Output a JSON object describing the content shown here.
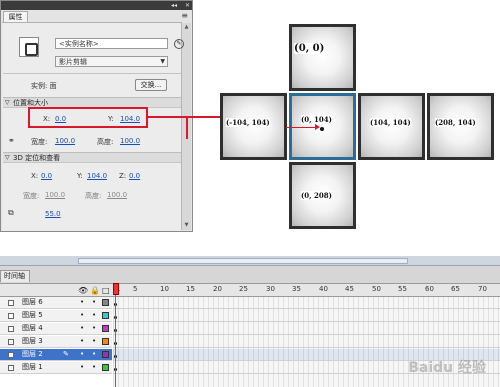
{
  "panel": {
    "tab": "属性",
    "instance_name_placeholder": "<实例名称>",
    "type": "影片剪辑",
    "instance_label": "实例: 面",
    "swap_button": "交换...",
    "section_position": "位置和大小",
    "x_label": "X:",
    "x_value": "0.0",
    "y_label": "Y:",
    "y_value": "104.0",
    "width_label": "宽度:",
    "width_value": "100.0",
    "height_label": "高度:",
    "height_value": "100.0",
    "section_3d": "3D 定位和查看",
    "x3d_label": "X:",
    "x3d_value": "0.0",
    "y3d_label": "Y:",
    "y3d_value": "104.0",
    "z3d_label": "Z:",
    "z3d_value": "0.0",
    "width3d_label": "宽度:",
    "width3d_value": "100.0",
    "height3d_label": "高度:",
    "height3d_value": "100.0",
    "fov_value": "55.0"
  },
  "stage": {
    "cells": [
      {
        "id": "top",
        "label": "(0, 0)"
      },
      {
        "id": "left",
        "label": "(-104, 104)"
      },
      {
        "id": "center",
        "label": "(0, 104)"
      },
      {
        "id": "right1",
        "label": "(104, 104)"
      },
      {
        "id": "right2",
        "label": "(208, 104)"
      },
      {
        "id": "bottom",
        "label": "(0, 208)"
      }
    ]
  },
  "timeline": {
    "tab": "时间轴",
    "frame_ticks": [
      "1",
      "5",
      "10",
      "15",
      "20",
      "25",
      "30",
      "35",
      "40",
      "45",
      "50",
      "55",
      "60",
      "65",
      "70"
    ],
    "layers": [
      {
        "name": "图层 6",
        "color": "#888888",
        "selected": false
      },
      {
        "name": "图层 5",
        "color": "#33cccc",
        "selected": false
      },
      {
        "name": "图层 4",
        "color": "#cc33cc",
        "selected": false
      },
      {
        "name": "图层 3",
        "color": "#ff8800",
        "selected": false
      },
      {
        "name": "图层 2",
        "color": "#8833cc",
        "selected": true
      },
      {
        "name": "图层 1",
        "color": "#33cc33",
        "selected": false
      }
    ]
  },
  "colors": {
    "accent_red": "#d8182b",
    "selection_blue": "#3f72c9"
  }
}
